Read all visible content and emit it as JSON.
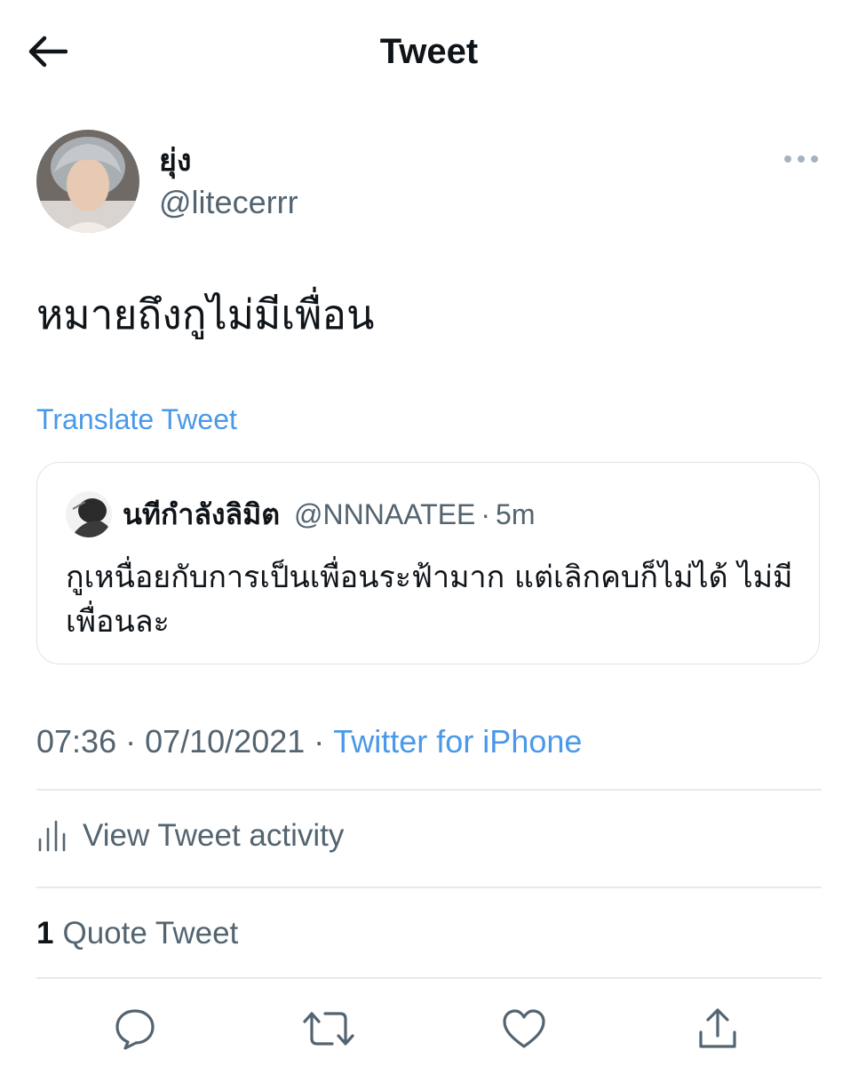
{
  "header": {
    "title": "Tweet"
  },
  "author": {
    "name": "ยุ่ง",
    "handle": "@litecerrr"
  },
  "tweet": {
    "text": "หมายถึงกูไม่มีเพื่อน",
    "translate_label": "Translate Tweet"
  },
  "quoted": {
    "name": "นทีกำลังลิมิต",
    "handle": "@NNNAATEE",
    "separator": "·",
    "time": "5m",
    "text": "กูเหนื่อยกับการเป็นเพื่อนระฟ้ามาก แต่เลิกคบก็ไม่ได้ ไม่มีเพื่อนละ"
  },
  "meta": {
    "time": "07:36",
    "separator": "·",
    "date": "07/10/2021",
    "source": "Twitter for iPhone"
  },
  "activity": {
    "label": "View Tweet activity"
  },
  "quotes": {
    "count": "1",
    "label": "Quote Tweet"
  },
  "actions": [
    "reply-icon",
    "retweet-icon",
    "like-icon",
    "share-icon"
  ],
  "colors": {
    "link": "#4a99e9",
    "secondary": "#536471",
    "text": "#0f1419",
    "divider": "#e6eaed"
  }
}
